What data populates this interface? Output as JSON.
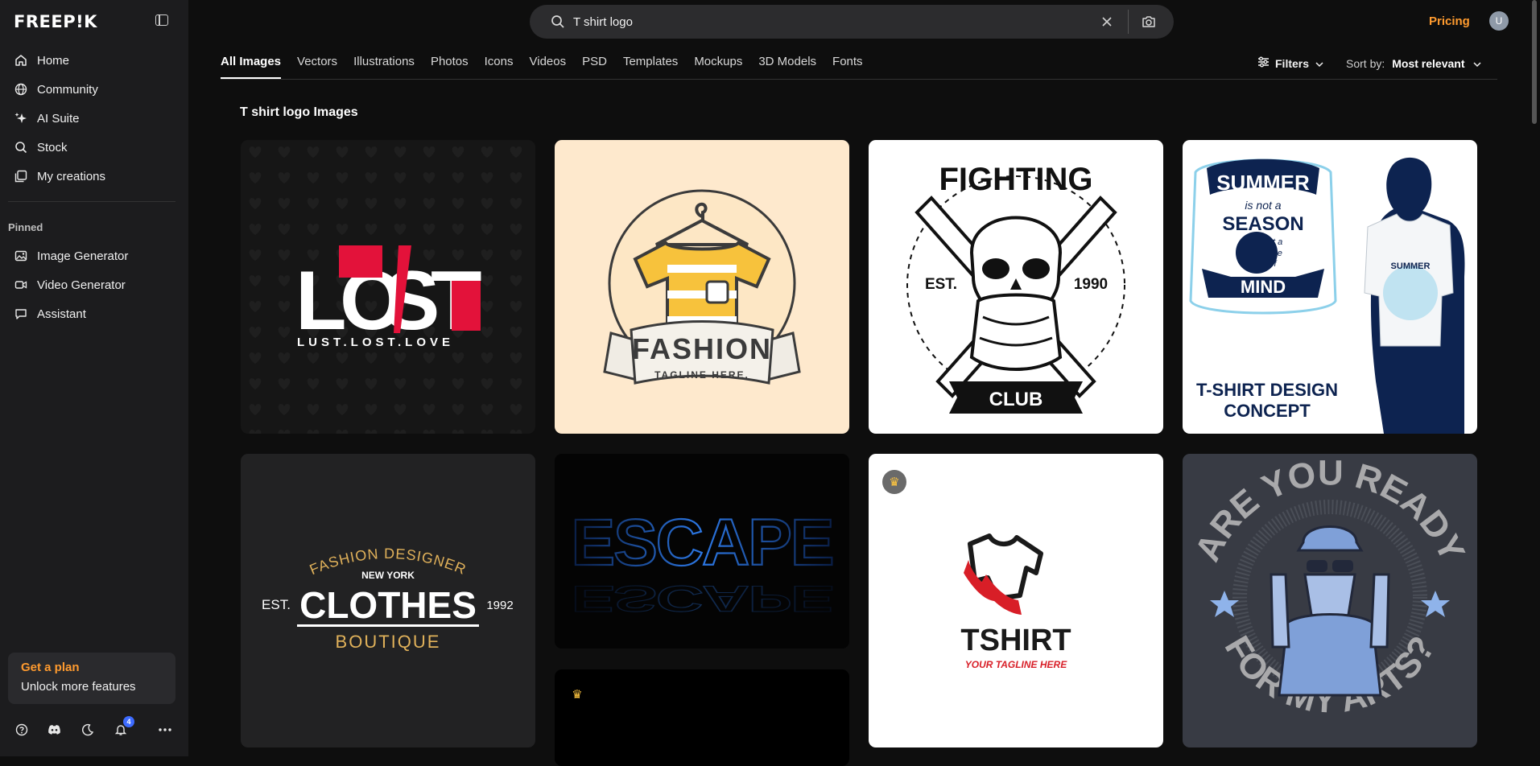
{
  "app": {
    "logo": "FREEP!K"
  },
  "sidebar": {
    "nav": [
      {
        "label": "Home",
        "icon": "home-icon"
      },
      {
        "label": "Community",
        "icon": "globe-icon"
      },
      {
        "label": "AI Suite",
        "icon": "sparkle-icon"
      },
      {
        "label": "Stock",
        "icon": "search-icon"
      },
      {
        "label": "My creations",
        "icon": "folder-icon"
      }
    ],
    "pinned_label": "Pinned",
    "pinned": [
      {
        "label": "Image Generator",
        "icon": "image-icon"
      },
      {
        "label": "Video Generator",
        "icon": "video-icon"
      },
      {
        "label": "Assistant",
        "icon": "chat-icon"
      }
    ],
    "plan": {
      "title": "Get a plan",
      "subtitle": "Unlock more features"
    },
    "notifications_count": "4"
  },
  "header": {
    "search_value": "T shirt logo",
    "pricing": "Pricing",
    "avatar_initial": "U"
  },
  "tabs": [
    "All Images",
    "Vectors",
    "Illustrations",
    "Photos",
    "Icons",
    "Videos",
    "PSD",
    "Templates",
    "Mockups",
    "3D Models",
    "Fonts"
  ],
  "active_tab": "All Images",
  "filters_label": "Filters",
  "sort": {
    "label": "Sort by:",
    "value": "Most relevant"
  },
  "results": {
    "heading": "T shirt logo Images",
    "cards": [
      {
        "id": "lust",
        "text": [
          "L",
          "O",
          "S",
          "T",
          "LUST.LOST.LOVE"
        ]
      },
      {
        "id": "fashion",
        "text": [
          "FASHION",
          "TAGLINE HERE."
        ]
      },
      {
        "id": "fighting",
        "text": [
          "FIGHTING",
          "EST.",
          "1990",
          "CLUB"
        ]
      },
      {
        "id": "summer",
        "text": [
          "SUMMER",
          "is not a",
          "SEASON",
          "but a",
          "state",
          "of",
          "MIND",
          "T-SHIRT DESIGN",
          "CONCEPT"
        ]
      },
      {
        "id": "clothes",
        "text": [
          "FASHION DESIGNER",
          "NEW YORK",
          "EST.",
          "CLOTHES",
          "1992",
          "BOUTIQUE"
        ]
      },
      {
        "id": "escape",
        "text": [
          "ESCAPE"
        ]
      },
      {
        "id": "tshirt",
        "text": [
          "TSHIRT",
          "YOUR TAGLINE HERE"
        ]
      },
      {
        "id": "ready",
        "text": [
          "ARE YOU READY",
          "FOR MY ARTS?"
        ]
      },
      {
        "id": "dark"
      }
    ]
  },
  "colors": {
    "accent": "#ff9b2f",
    "sidebar_bg": "#1c1c1e",
    "page_bg": "#0e0e0e"
  }
}
